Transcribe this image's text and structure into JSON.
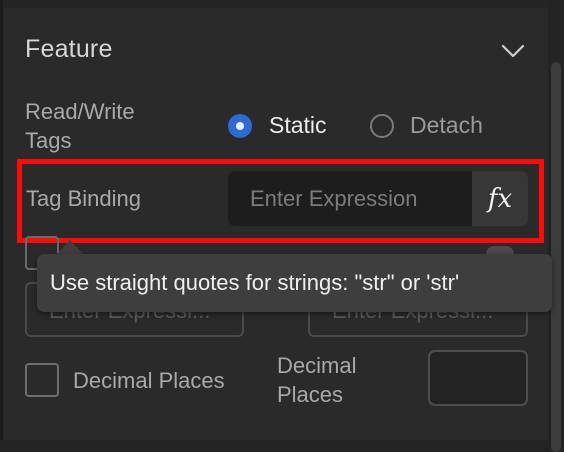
{
  "section": {
    "title": "Feature"
  },
  "read_write_tags": {
    "label_line1": "Read/Write",
    "label_line2": "Tags",
    "options": [
      {
        "label": "Static",
        "selected": true
      },
      {
        "label": "Detach",
        "selected": false
      }
    ]
  },
  "tag_binding": {
    "label": "Tag Binding",
    "placeholder": "Enter Expression",
    "fx_label": "fx"
  },
  "tooltip": {
    "text": "Use straight quotes for strings: \"str\" or 'str'"
  },
  "obscured_row": {
    "left_placeholder": "Enter Expressi...",
    "right_placeholder": "Enter Expressi..."
  },
  "decimal_places": {
    "checkbox_label": "Decimal Places",
    "field_label_line1": "Decimal",
    "field_label_line2": "Places",
    "value": ""
  },
  "colors": {
    "accent": "#2d6bd2",
    "highlight": "#ff0a0a",
    "background": "#2a2a2a"
  },
  "icons": {
    "collapse": "chevron-down-icon",
    "expression": "fx-icon"
  }
}
